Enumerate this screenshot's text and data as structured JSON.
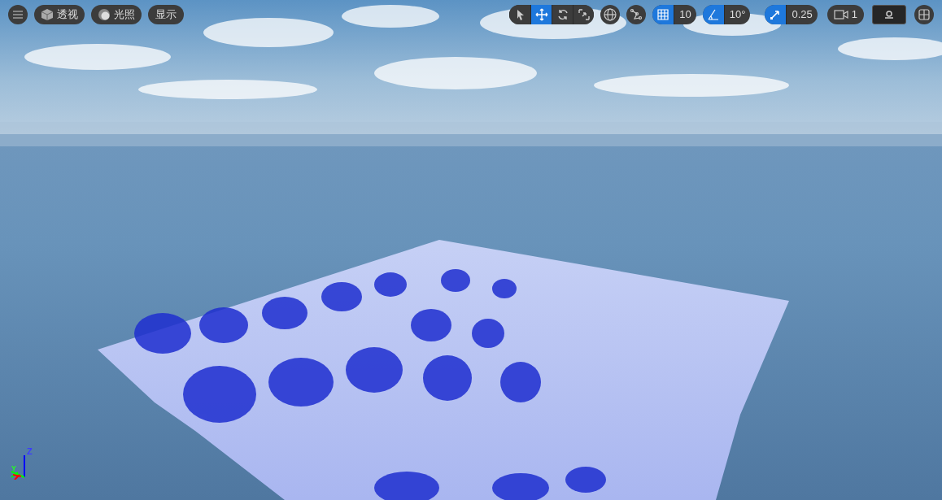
{
  "left_toolbar": {
    "view_mode": "透视",
    "lighting": "光照",
    "show": "显示"
  },
  "transform_tools": [
    {
      "kind": "select",
      "selected": false
    },
    {
      "kind": "translate",
      "selected": true
    },
    {
      "kind": "rotate",
      "selected": false
    },
    {
      "kind": "scale",
      "selected": false
    }
  ],
  "snaps": [
    {
      "kind": "grid",
      "on": true,
      "value": "10"
    },
    {
      "kind": "angle",
      "on": true,
      "value": "10°"
    },
    {
      "kind": "scale",
      "on": true,
      "value": "0.25"
    }
  ],
  "camera_speed": "1",
  "axis_labels": [
    "Z",
    "Y"
  ]
}
